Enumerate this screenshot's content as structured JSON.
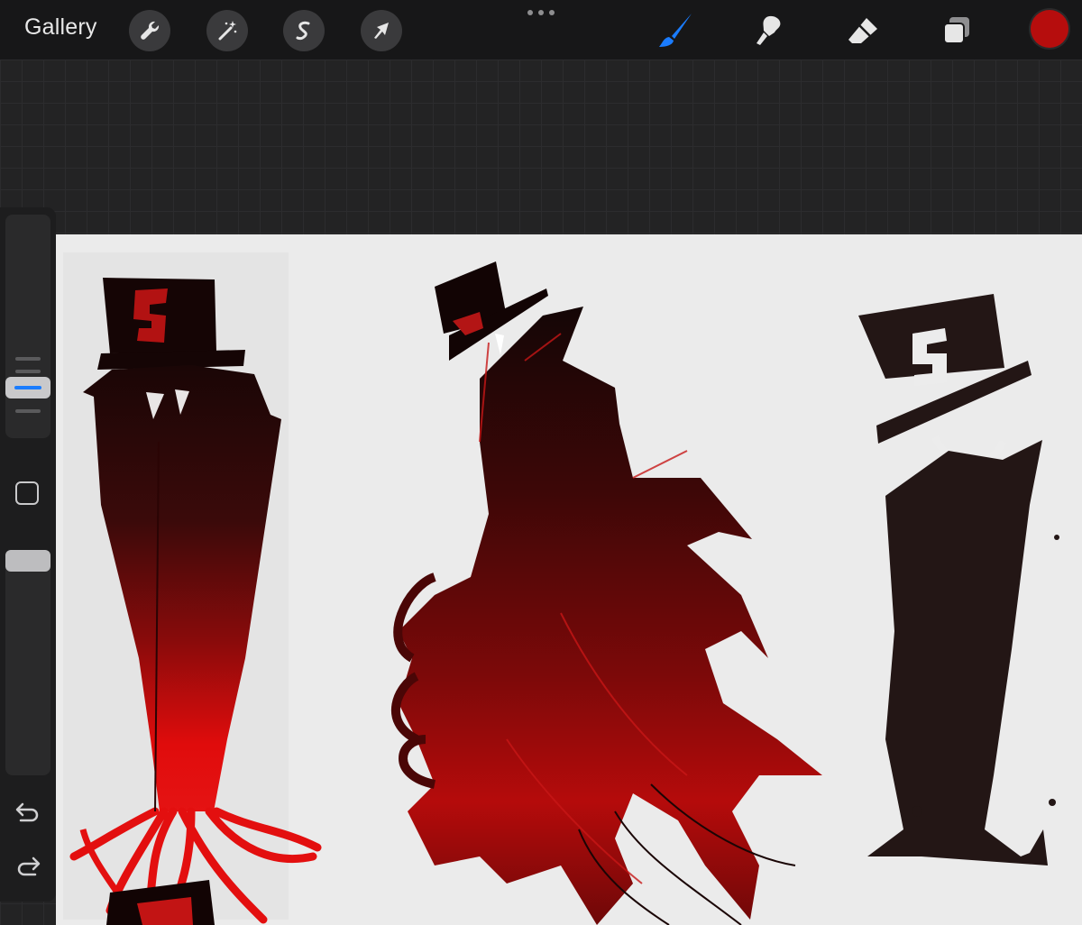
{
  "topbar": {
    "gallery_label": "Gallery",
    "left_tools": [
      "wrench-icon",
      "magic-wand-icon",
      "selection-s-icon",
      "arrow-transform-icon"
    ],
    "right_tools": [
      "brush-icon",
      "smudge-icon",
      "eraser-icon",
      "layers-icon"
    ],
    "active_tool": "brush-icon",
    "active_color": "#b60d0d",
    "accent_color": "#1a7cff"
  },
  "sidebar": {
    "controls": [
      "brush-size-slider",
      "modify-button",
      "opacity-slider",
      "undo-icon",
      "redo-icon"
    ]
  },
  "canvas": {
    "artwork": [
      "red-tophat-figure-left",
      "red-clawed-figure-center",
      "black-tophat-figure-right"
    ]
  }
}
